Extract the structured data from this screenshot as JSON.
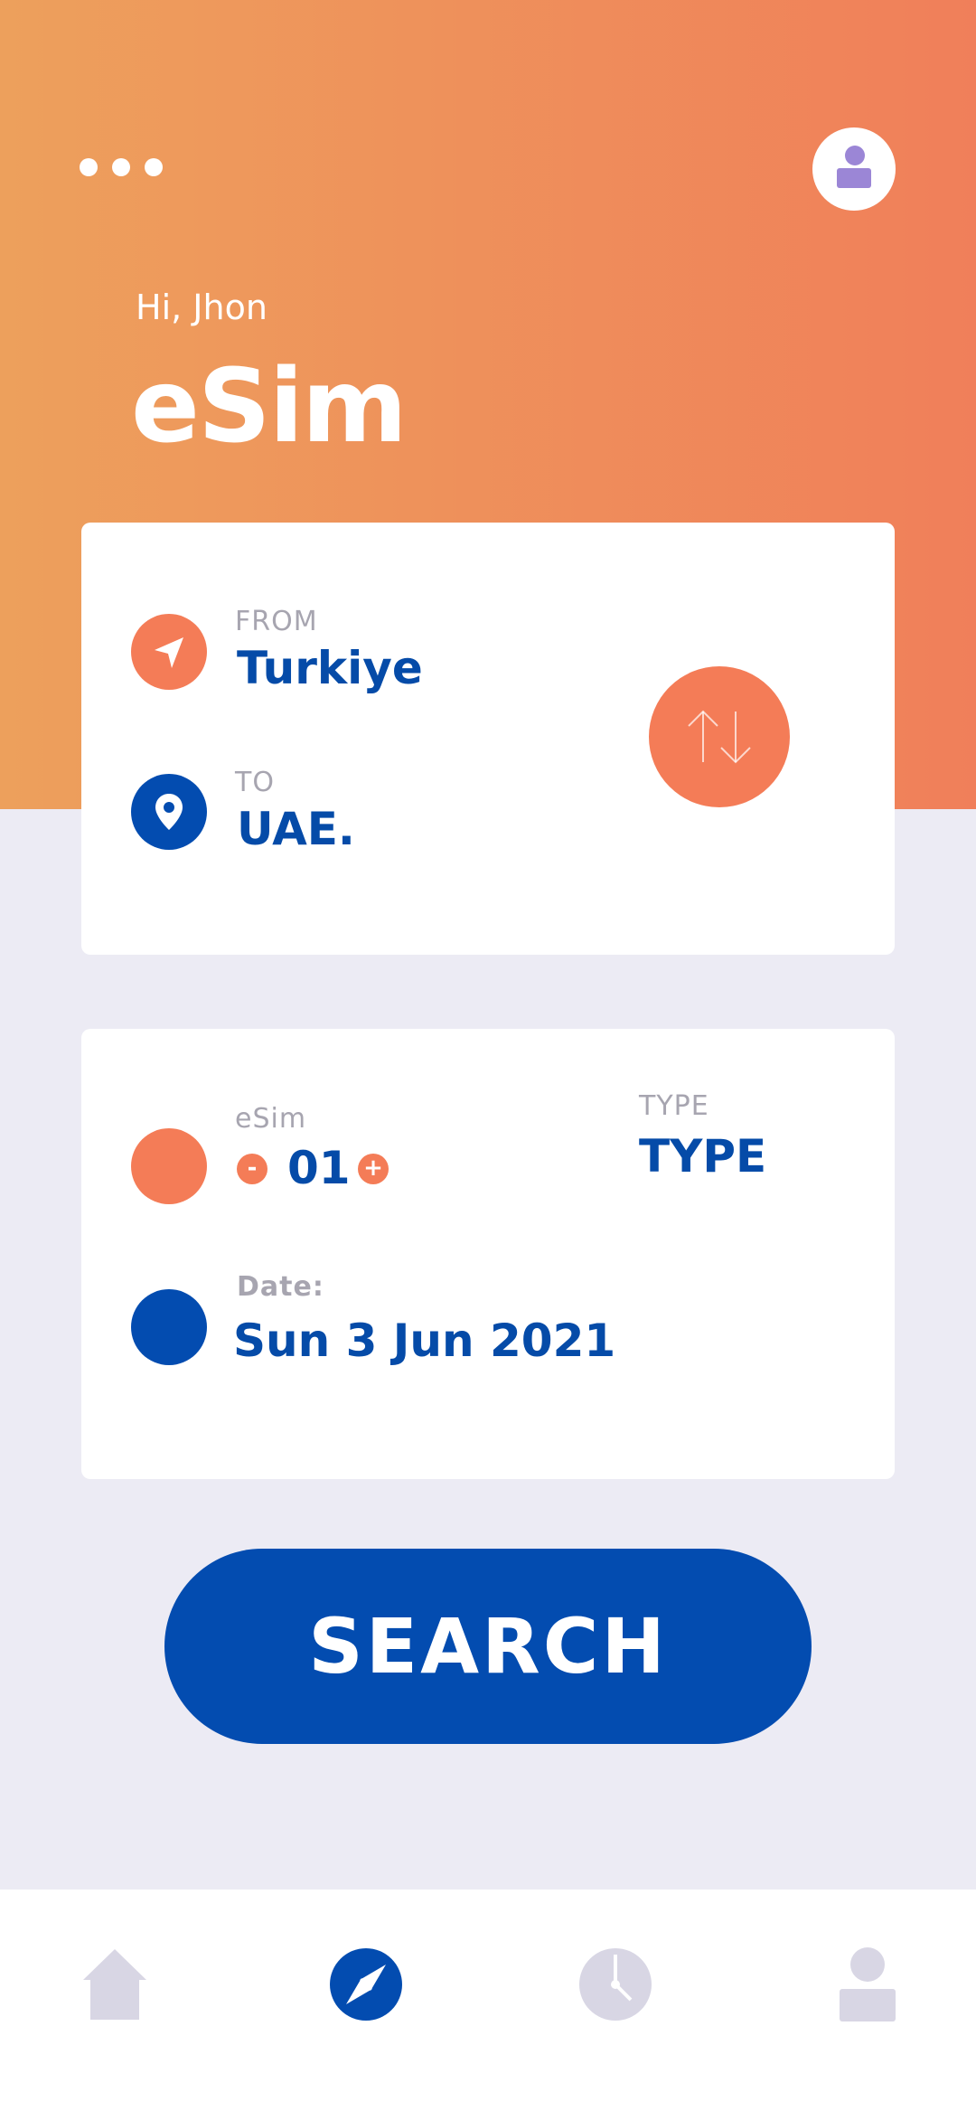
{
  "header": {
    "greeting": "Hi, Jhon",
    "title": "eSim",
    "menu_icon": "more-dots-icon",
    "profile_icon": "user-avatar-icon"
  },
  "route": {
    "from_label": "FROM",
    "from_value": "Turkiye",
    "to_label": "TO",
    "to_value": "UAE.",
    "from_icon": "navigation-arrow-icon",
    "to_icon": "location-pin-icon",
    "swap_icon": "swap-arrows-icon"
  },
  "details": {
    "esim_label": "eSim",
    "esim_count": "01",
    "minus_label": "-",
    "plus_label": "+",
    "type_label": "TYPE",
    "type_value": "TYPE",
    "date_label": "Date:",
    "date_value": "Sun 3 Jun 2021"
  },
  "search": {
    "label": "SEARCH"
  },
  "nav": {
    "items": [
      "home-icon",
      "compass-icon",
      "clock-icon",
      "profile-icon"
    ],
    "active": "compass-icon"
  },
  "colors": {
    "accent_orange": "#F47C57",
    "brand_blue": "#034CB0",
    "background": "#ECEBF4",
    "muted": "#D8D6E4"
  }
}
